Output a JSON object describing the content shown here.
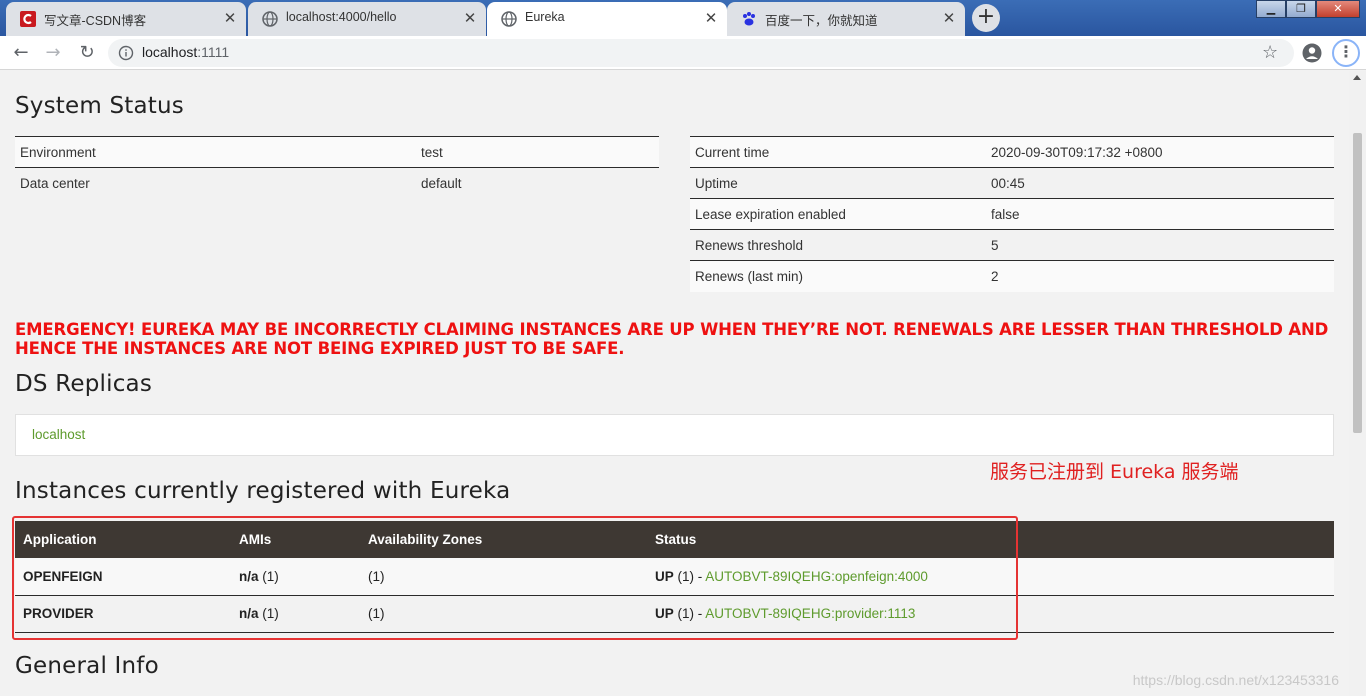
{
  "browser": {
    "tabs": [
      {
        "title": "写文章-CSDN博客",
        "icon": "csdn-icon"
      },
      {
        "title": "localhost:4000/hello",
        "icon": "globe-icon"
      },
      {
        "title": "Eureka",
        "icon": "globe-icon",
        "active": true
      },
      {
        "title": "百度一下，你就知道",
        "icon": "baidu-paw-icon"
      }
    ],
    "url_host": "localhost",
    "url_port": ":1111"
  },
  "system_status": {
    "title": "System Status",
    "left": [
      {
        "key": "Environment",
        "value": "test"
      },
      {
        "key": "Data center",
        "value": "default"
      }
    ],
    "right": [
      {
        "key": "Current time",
        "value": "2020-09-30T09:17:32 +0800"
      },
      {
        "key": "Uptime",
        "value": "00:45"
      },
      {
        "key": "Lease expiration enabled",
        "value": "false"
      },
      {
        "key": "Renews threshold",
        "value": "5"
      },
      {
        "key": "Renews (last min)",
        "value": "2"
      }
    ]
  },
  "emergency": "EMERGENCY! EUREKA MAY BE INCORRECTLY CLAIMING INSTANCES ARE UP WHEN THEY’RE NOT. RENEWALS ARE LESSER THAN THRESHOLD AND HENCE THE INSTANCES ARE NOT BEING EXPIRED JUST TO BE SAFE.",
  "replicas": {
    "title": "DS Replicas",
    "items": [
      "localhost"
    ]
  },
  "annotation": "服务已注册到 Eureka 服务端",
  "instances": {
    "title": "Instances currently registered with Eureka",
    "headers": [
      "Application",
      "AMIs",
      "Availability Zones",
      "Status"
    ],
    "rows": [
      {
        "app": "OPENFEIGN",
        "amis_main": "n/a",
        "amis_count": " (1)",
        "zones": "(1)",
        "status_main": "UP",
        "status_count": " (1) - ",
        "status_link": "AUTOBVT-89IQEHG:openfeign:4000"
      },
      {
        "app": "PROVIDER",
        "amis_main": "n/a",
        "amis_count": " (1)",
        "zones": "(1)",
        "status_main": "UP",
        "status_count": " (1) - ",
        "status_link": "AUTOBVT-89IQEHG:provider:1113"
      }
    ]
  },
  "general_info": {
    "title": "General Info"
  },
  "watermark": "https://blog.csdn.net/x123453316"
}
